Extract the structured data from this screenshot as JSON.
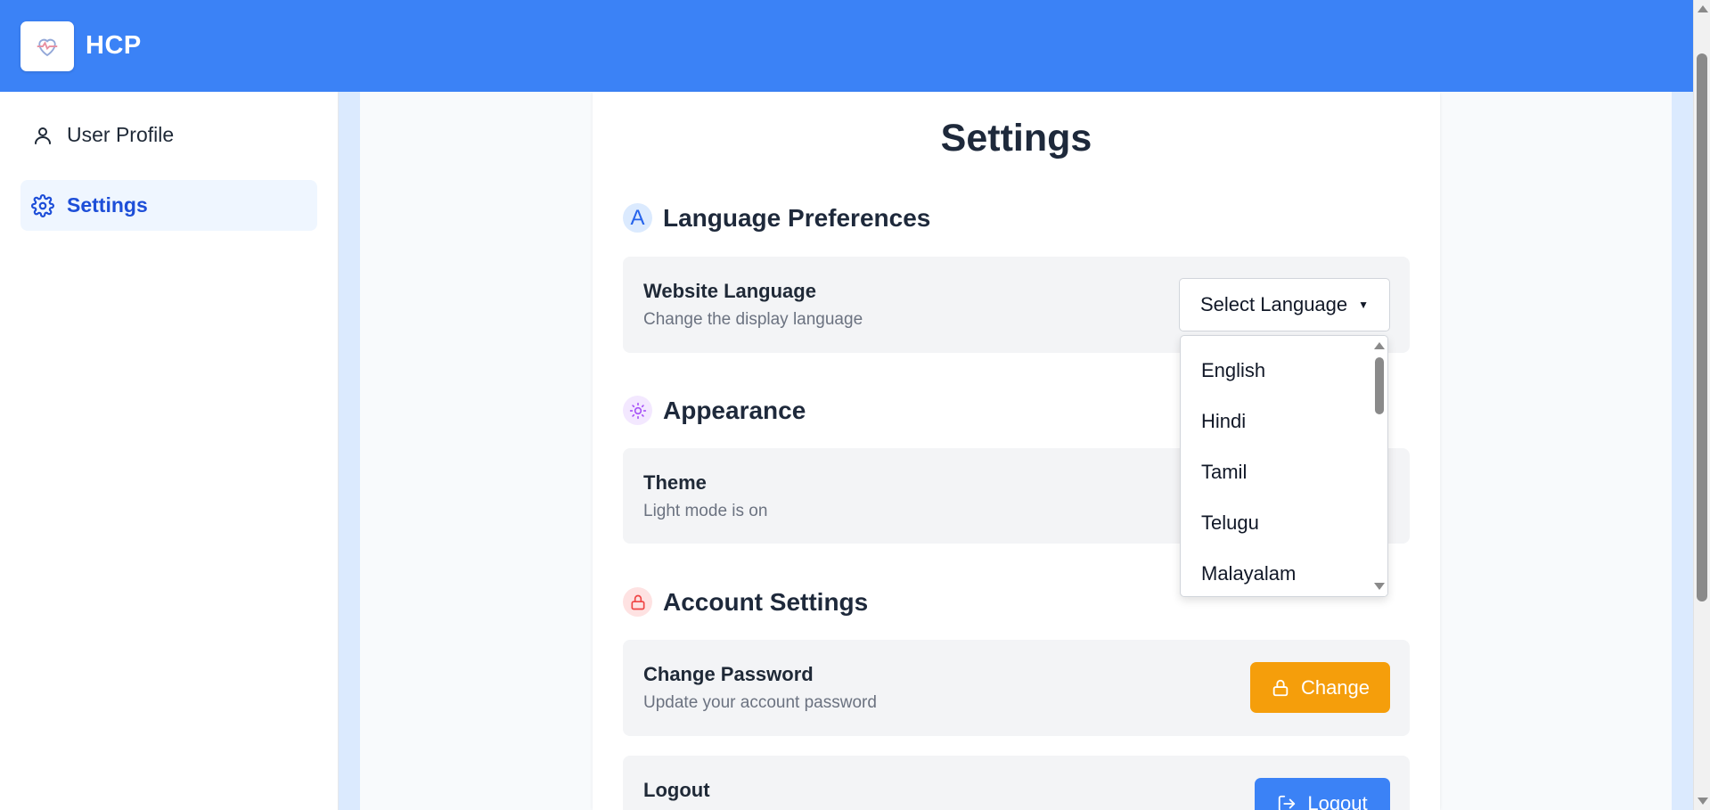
{
  "header": {
    "brand": "HCP",
    "logo_icon": "heart-pulse-icon"
  },
  "sidebar": {
    "items": [
      {
        "label": "User Profile",
        "icon": "user-icon",
        "active": false
      },
      {
        "label": "Settings",
        "icon": "gear-icon",
        "active": true
      }
    ]
  },
  "main": {
    "title": "Settings",
    "language": {
      "heading": "Language Preferences",
      "icon_letter": "A",
      "item_title": "Website Language",
      "item_sub": "Change the display language",
      "select_label": "Select Language",
      "options": [
        "English",
        "Hindi",
        "Tamil",
        "Telugu",
        "Malayalam"
      ]
    },
    "appearance": {
      "heading": "Appearance",
      "item_title": "Theme",
      "item_sub": "Light mode is on"
    },
    "account": {
      "heading": "Account Settings",
      "password_title": "Change Password",
      "password_sub": "Update your account password",
      "change_label": "Change",
      "logout_title": "Logout",
      "logout_label": "Logout"
    }
  },
  "colors": {
    "primary": "#3b82f6",
    "warning": "#f59e0b",
    "active_text": "#1d4ed8",
    "appearance_accent": "#a855f7",
    "account_accent": "#ef4444"
  }
}
